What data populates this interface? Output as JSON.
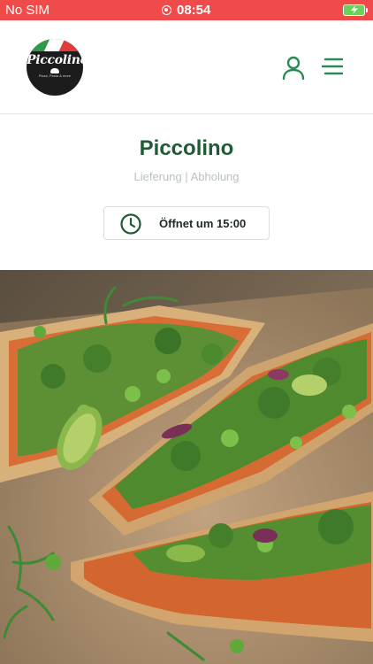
{
  "status_bar": {
    "carrier": "No SIM",
    "time": "08:54",
    "battery_state": "charging",
    "background_color": "#f14a4a"
  },
  "header": {
    "logo": {
      "text": "Piccolino",
      "tagline": "Pizza, Pasta & more"
    },
    "user_icon": "user-icon",
    "menu_icon": "menu-icon"
  },
  "restaurant": {
    "name": "Piccolino",
    "service_modes": "Lieferung | Abholung",
    "opening": {
      "icon": "clock-icon",
      "label": "Öffnet um 15:00"
    }
  },
  "hero_image": {
    "description_icon": "pizza-photo"
  },
  "colors": {
    "brand_green": "#1f5b34",
    "accent_green": "#2a8a55",
    "status_red": "#f14a4a"
  }
}
